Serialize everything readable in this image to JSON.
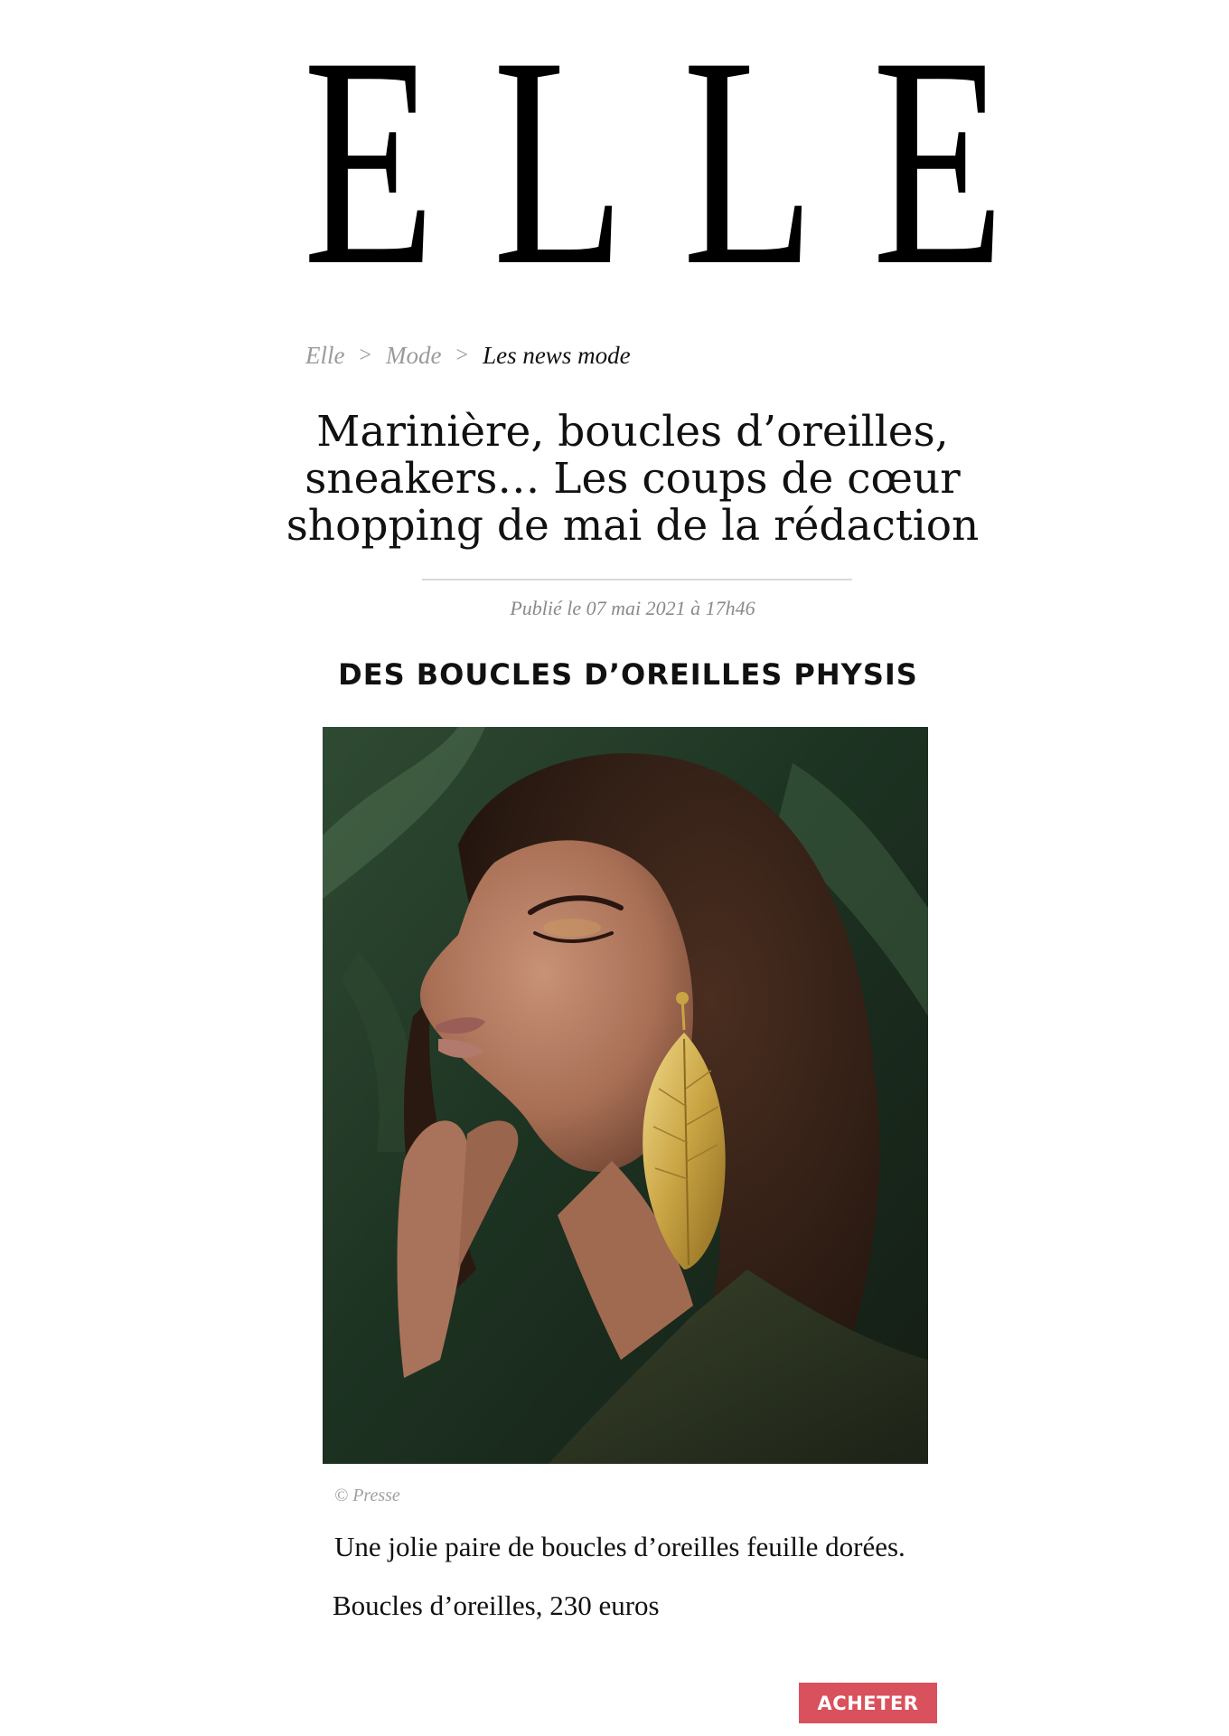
{
  "header": {
    "logo_letters": [
      "E",
      "L",
      "L",
      "E"
    ]
  },
  "breadcrumb": {
    "items": [
      "Elle",
      "Mode",
      "Les news mode"
    ],
    "separator": ">"
  },
  "article": {
    "title_lines": [
      "Marinière, boucles d’oreilles,",
      "sneakers… Les coups de cœur",
      "shopping de mai de la rédaction"
    ],
    "published": "Publié le 07 mai 2021 à 17h46"
  },
  "product": {
    "section_title": "DES BOUCLES D’OREILLES PHYSIS",
    "image_credit": "© Presse",
    "description": "Une jolie paire de boucles d’oreilles feuille dorées.",
    "price_line": "Boucles d’oreilles, 230 euros",
    "buy_label": "ACHETER"
  },
  "colors": {
    "accent": "#d9515c",
    "breadcrumb_muted": "#9a9a9a",
    "rule": "#d9d9d9"
  },
  "icons": {
    "photo": "portrait-photo"
  }
}
